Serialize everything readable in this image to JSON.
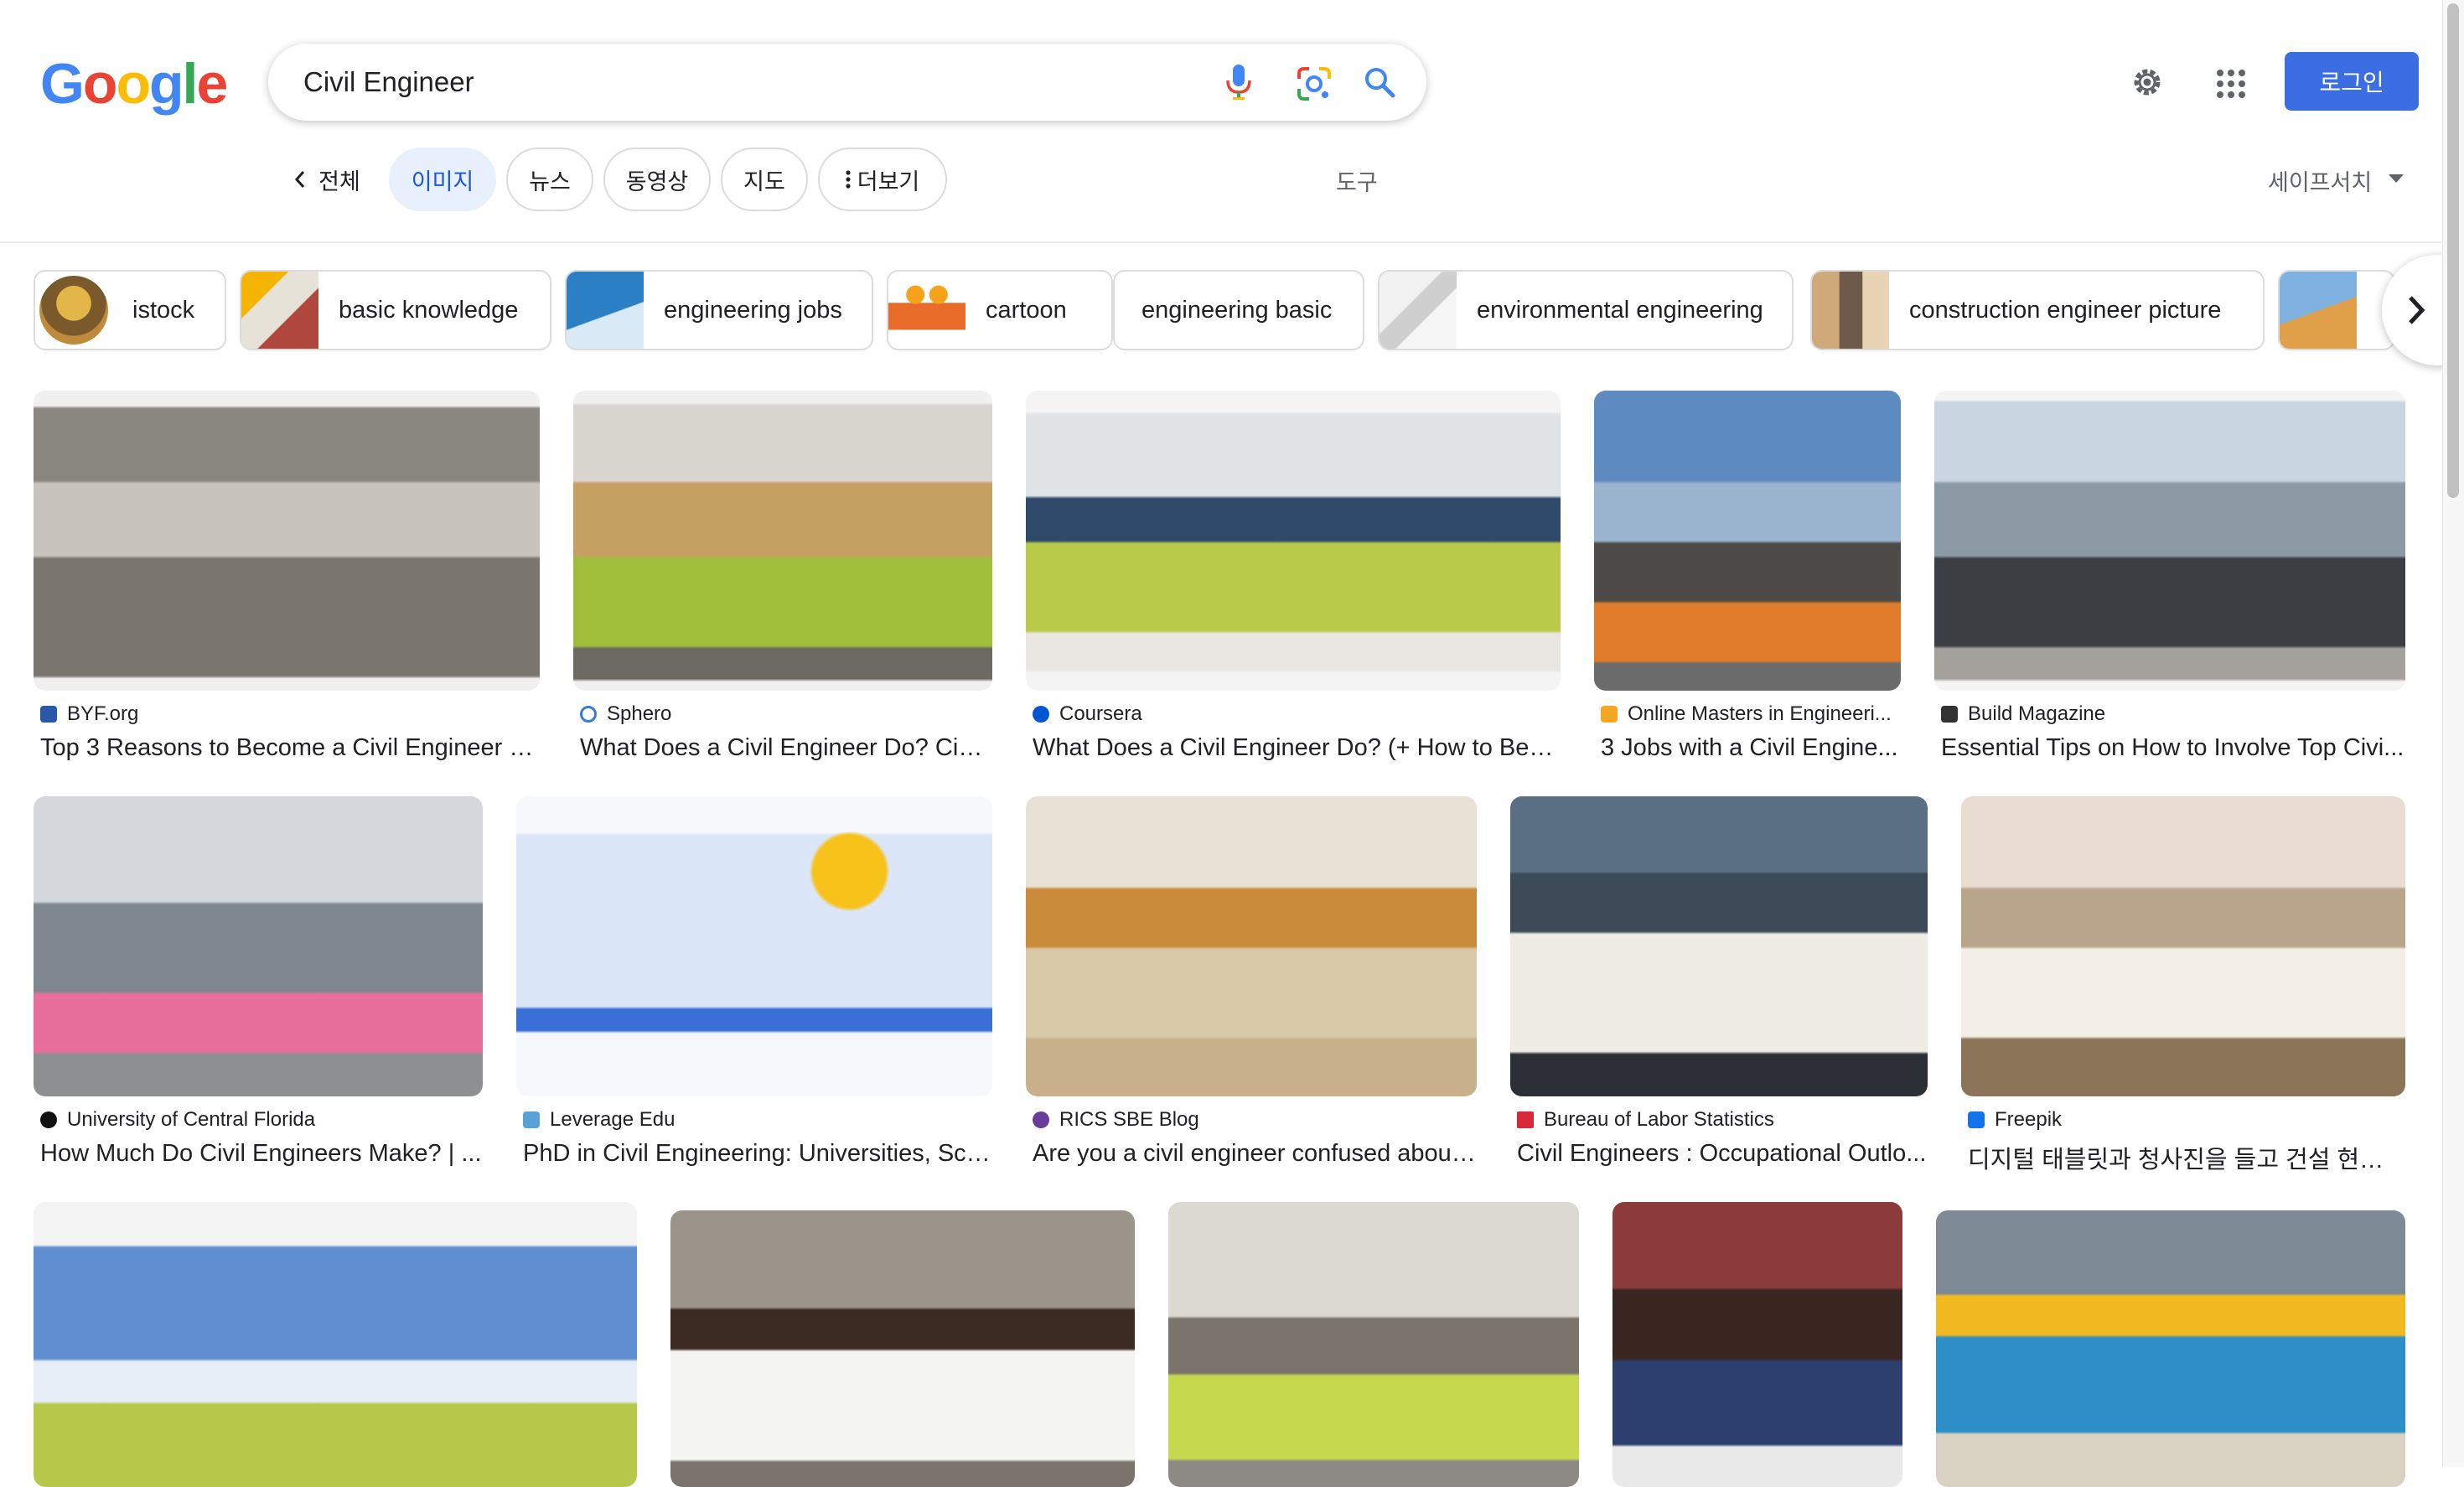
{
  "logo": {
    "letters": [
      "G",
      "o",
      "o",
      "g",
      "l",
      "e"
    ],
    "colors": [
      "#4285F4",
      "#EA4335",
      "#FBBC05",
      "#4285F4",
      "#34A853",
      "#EA4335"
    ]
  },
  "search": {
    "query": "Civil Engineer"
  },
  "header": {
    "login_label": "로그인"
  },
  "tabs": {
    "all": "전체",
    "images": "이미지",
    "news": "뉴스",
    "videos": "동영상",
    "maps": "지도",
    "more": "더보기",
    "tools": "도구",
    "safesearch": "세이프서치"
  },
  "chips": [
    {
      "label": "istock"
    },
    {
      "label": "basic knowledge"
    },
    {
      "label": "engineering jobs"
    },
    {
      "label": "cartoon"
    },
    {
      "label": "engineering basic"
    },
    {
      "label": "environmental engineering"
    },
    {
      "label": "construction engineer picture"
    }
  ],
  "results": [
    {
      "source": "BYF.org",
      "title": "Top 3 Reasons to Become a Civil Engineer - ..."
    },
    {
      "source": "Sphero",
      "title": "What Does a Civil Engineer Do? Civil..."
    },
    {
      "source": "Coursera",
      "title": "What Does a Civil Engineer Do? (+ How to Beco..."
    },
    {
      "source": "Online Masters in Engineeri...",
      "title": "3 Jobs with a Civil Engine..."
    },
    {
      "source": "Build Magazine",
      "title": "Essential Tips on How to Involve Top Civi..."
    },
    {
      "source": "University of Central Florida",
      "title": "How Much Do Civil Engineers Make? | ..."
    },
    {
      "source": "Leverage Edu",
      "title": "PhD in Civil Engineering: Universities, Sco..."
    },
    {
      "source": "RICS SBE Blog",
      "title": "Are you a civil engineer confused about..."
    },
    {
      "source": "Bureau of Labor Statistics",
      "title": "Civil Engineers : Occupational Outlo..."
    },
    {
      "source": "Freepik",
      "title": "디지털 태블릿과 청사진을 들고 건설 현장 협..."
    }
  ]
}
